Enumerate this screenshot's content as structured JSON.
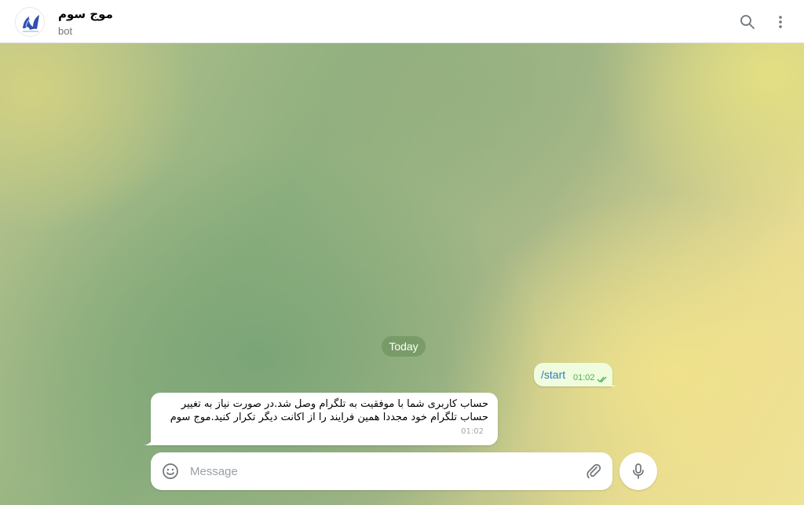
{
  "header": {
    "title": "موج سوم",
    "subtitle": "bot",
    "avatar_icon": "bot-logo-icon",
    "search_icon": "search-icon",
    "more_icon": "more-vertical-icon"
  },
  "chat": {
    "date_label": "Today",
    "messages": [
      {
        "direction": "outgoing",
        "text": "/start",
        "time": "01:02",
        "status_icon": "double-check-icon"
      },
      {
        "direction": "incoming",
        "text": "حساب کاربری شما با موفقیت به تلگرام وصل شد.در صورت نیاز به تغییر حساب تلگرام خود مجددا همین فرایند را از اکانت دیگر تکرار کنید.موج سوم",
        "time": "01:02"
      }
    ]
  },
  "composer": {
    "placeholder": "Message",
    "value": "",
    "emoji_icon": "emoji-icon",
    "attach_icon": "paperclip-icon",
    "mic_icon": "microphone-icon"
  },
  "colors": {
    "outgoing_bubble": "#effdde",
    "incoming_bubble": "#ffffff",
    "accent_text": "#2f7bbf",
    "check_green": "#4fae4e",
    "date_pill": "#7a9860"
  }
}
